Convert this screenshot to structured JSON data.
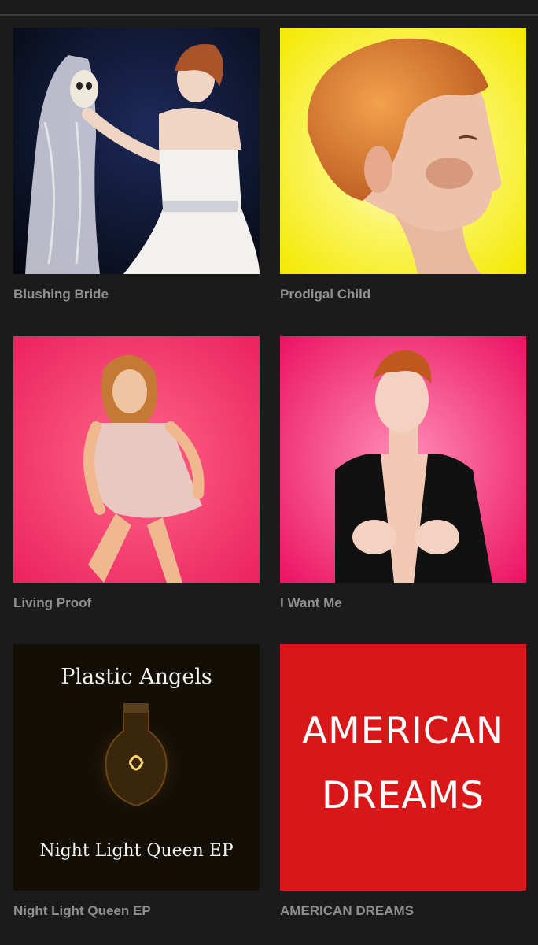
{
  "albums": [
    {
      "title": "Blushing Bride"
    },
    {
      "title": "Prodigal Child"
    },
    {
      "title": "Living Proof"
    },
    {
      "title": "I Want Me"
    },
    {
      "title": "Night Light Queen EP",
      "cover_text": {
        "top": "Plastic Angels",
        "bottom": "Night Light Queen EP"
      }
    },
    {
      "title": "AMERICAN DREAMS",
      "cover_text": {
        "line1": "AMERICAN",
        "line2": "DREAMS"
      }
    }
  ],
  "colors": {
    "background": "#1b1b1b",
    "title_text": "#8f8f8f",
    "yellow_cover": "#f7ef00",
    "pink_cover": "#f0106e",
    "red_cover": "#d81818"
  }
}
